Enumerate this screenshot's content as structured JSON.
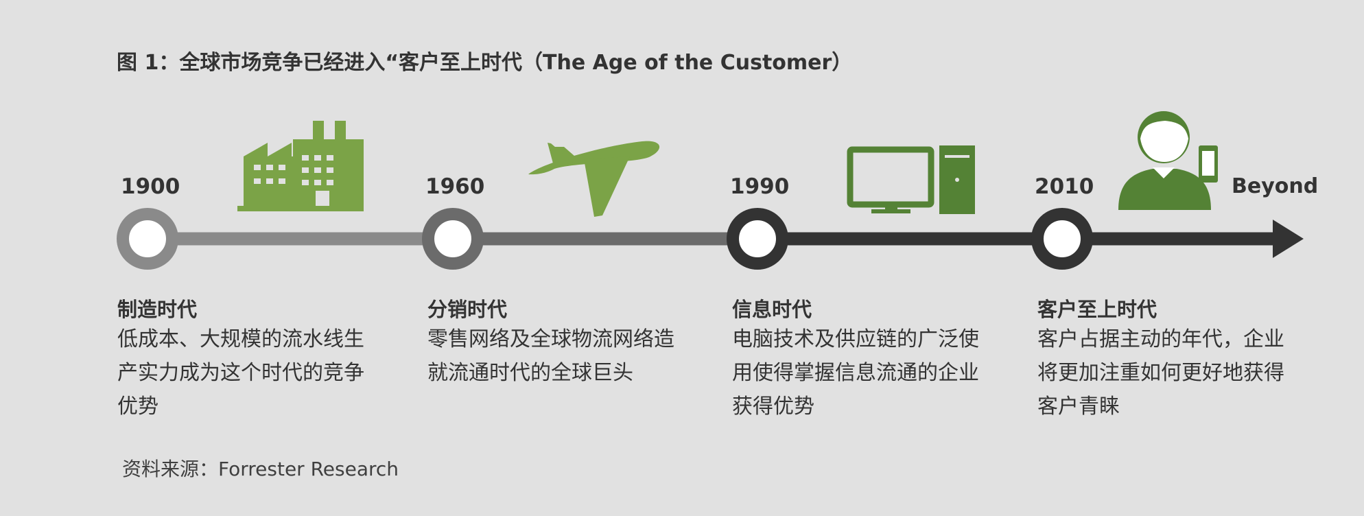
{
  "title": "图 1：全球市场竞争已经进入“客户至上时代（The Age of the Customer）",
  "timeline": {
    "years": [
      "1900",
      "1960",
      "1990",
      "2010"
    ],
    "end_label": "Beyond",
    "colors": {
      "accent_green": "#7ba347",
      "dark_green": "#548235",
      "light_line": "#8a8a8a",
      "mid_line": "#6b6b6b",
      "dark_line": "#333333"
    }
  },
  "eras": [
    {
      "title": "制造时代",
      "desc": "低成本、大规模的流水线生产实力成为这个时代的竞争优势",
      "icon": "factory-icon"
    },
    {
      "title": "分销时代",
      "desc": "零售网络及全球物流网络造就流通时代的全球巨头",
      "icon": "airplane-icon"
    },
    {
      "title": "信息时代",
      "desc": "电脑技术及供应链的广泛使用使得掌握信息流通的企业获得优势",
      "icon": "computer-icon"
    },
    {
      "title": "客户至上时代",
      "desc": "客户占据主动的年代，企业将更加注重如何更好地获得客户青睐",
      "icon": "customer-phone-icon"
    }
  ],
  "source": "资料来源：Forrester Research"
}
